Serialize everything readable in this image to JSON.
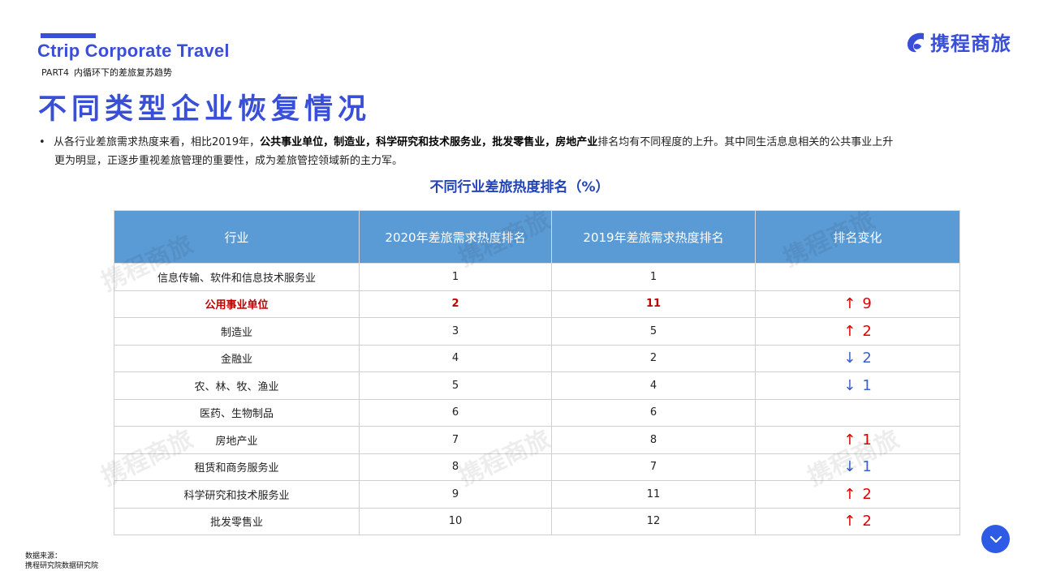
{
  "header": {
    "brand_en": "Ctrip Corporate Travel",
    "part_no": "PART4",
    "part_title": "内循环下的差旅复苏趋势",
    "title": "不同类型企业恢复情况",
    "logo_text": "携程商旅",
    "accent_color": "#3a4fd8"
  },
  "bullet": {
    "seg1": "从各行业差旅需求热度来看，相比2019年，",
    "b1": "公共事业单位",
    "s1": "，",
    "b2": "制造业",
    "s2": "，",
    "b3": "科学研究和技术服务业",
    "s3": "，",
    "b4": "批发零售业",
    "s4": "，",
    "b5": "房地产业",
    "seg2": "排名均有不同程度的上升。其中同生活息息相关的公共事业上升",
    "seg3": "更为明显，正逐步重视差旅管理的重要性，成为差旅管控领域新的主力军。"
  },
  "table": {
    "title": "不同行业差旅热度排名（%）",
    "headers": [
      "行业",
      "2020年差旅需求热度排名",
      "2019年差旅需求热度排名",
      "排名变化"
    ],
    "rows": [
      {
        "industry": "信息传输、软件和信息技术服务业",
        "r2020": "1",
        "r2019": "1",
        "arrow": "",
        "change": ""
      },
      {
        "industry": "公用事业单位",
        "r2020": "2",
        "r2019": "11",
        "arrow": "↑",
        "change": "9"
      },
      {
        "industry": "制造业",
        "r2020": "3",
        "r2019": "5",
        "arrow": "↑",
        "change": "2"
      },
      {
        "industry": "金融业",
        "r2020": "4",
        "r2019": "2",
        "arrow": "↓",
        "change": "2"
      },
      {
        "industry": "农、林、牧、渔业",
        "r2020": "5",
        "r2019": "4",
        "arrow": "↓",
        "change": "1"
      },
      {
        "industry": "医药、生物制品",
        "r2020": "6",
        "r2019": "6",
        "arrow": "",
        "change": ""
      },
      {
        "industry": "房地产业",
        "r2020": "7",
        "r2019": "8",
        "arrow": "↑",
        "change": "1"
      },
      {
        "industry": "租赁和商务服务业",
        "r2020": "8",
        "r2019": "7",
        "arrow": "↓",
        "change": "1"
      },
      {
        "industry": "科学研究和技术服务业",
        "r2020": "9",
        "r2019": "11",
        "arrow": "↑",
        "change": "2"
      },
      {
        "industry": "批发零售业",
        "r2020": "10",
        "r2019": "12",
        "arrow": "↑",
        "change": "2"
      }
    ]
  },
  "source": {
    "label": "数据来源：",
    "value": "携程研究院数据研究院"
  },
  "fab_icon": "chevron-down-icon"
}
